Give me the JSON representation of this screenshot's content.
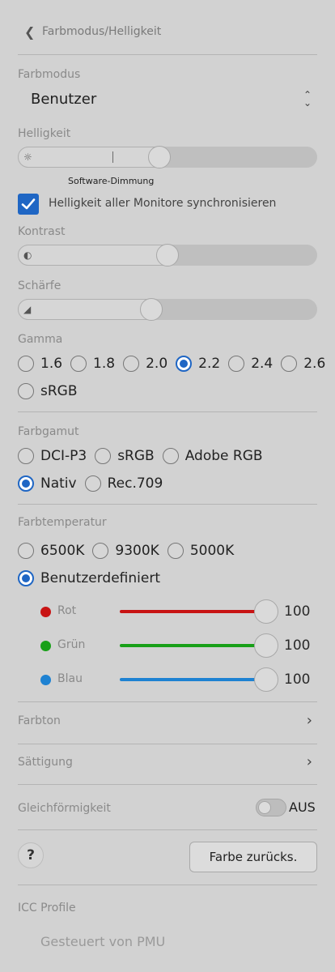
{
  "header": {
    "back_icon": "chevron-left-icon",
    "title": "Farbmodus/Helligkeit"
  },
  "color_mode": {
    "label": "Farbmodus",
    "value": "Benutzer",
    "icon": "up-down-chevron-icon"
  },
  "brightness": {
    "label": "Helligkeit",
    "icon": "sun-icon",
    "level": 0.47,
    "note": "Software-Dimmung"
  },
  "sync": {
    "label": "Helligkeit aller Monitore synchronisieren",
    "checked": true
  },
  "contrast": {
    "label": "Kontrast",
    "icon": "contrast-icon",
    "level": 0.5
  },
  "sharpness": {
    "label": "Schärfe",
    "icon": "sharpness-icon",
    "level": 0.45
  },
  "gamma": {
    "label": "Gamma",
    "options": [
      "1.6",
      "1.8",
      "2.0",
      "2.2",
      "2.4",
      "2.6",
      "sRGB"
    ],
    "selected": "2.2"
  },
  "gamut": {
    "label": "Farbgamut",
    "options": [
      "DCI-P3",
      "sRGB",
      "Adobe RGB",
      "Nativ",
      "Rec.709"
    ],
    "selected": "Nativ"
  },
  "temperature": {
    "label": "Farbtemperatur",
    "options": [
      "6500K",
      "9300K",
      "5000K",
      "Benutzerdefiniert"
    ],
    "selected": "Benutzerdefiniert",
    "channels": [
      {
        "name": "Rot",
        "value": "100",
        "color": "#c81414"
      },
      {
        "name": "Grün",
        "value": "100",
        "color": "#18a018"
      },
      {
        "name": "Blau",
        "value": "100",
        "color": "#1e82d2"
      }
    ]
  },
  "hue": {
    "label": "Farbton",
    "icon": "chevron-right-icon"
  },
  "saturation": {
    "label": "Sättigung",
    "icon": "chevron-right-icon"
  },
  "uniformity": {
    "label": "Gleichförmigkeit",
    "state": "AUS"
  },
  "help": {
    "label": "?"
  },
  "reset": {
    "label": "Farbe zurücks."
  },
  "icc": {
    "label": "ICC Profile",
    "value": "Gesteuert von PMU"
  },
  "accent_color": "#1f66c4"
}
